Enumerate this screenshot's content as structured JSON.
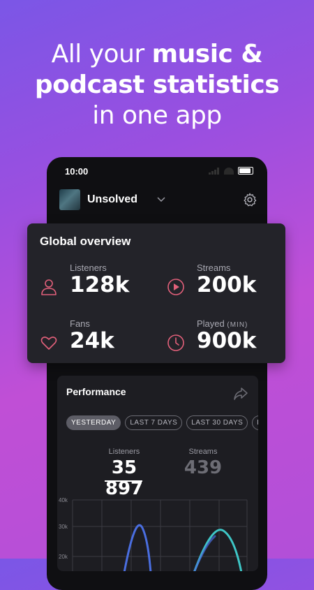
{
  "headline": {
    "part1": "All your ",
    "bold1": "music &",
    "bold2": "podcast statistics",
    "part3": "in one app"
  },
  "status_bar": {
    "time": "10:00"
  },
  "app_header": {
    "title": "Unsolved"
  },
  "global_overview": {
    "title": "Global overview",
    "stats": [
      {
        "label": "Listeners",
        "value": "128k",
        "icon": "person-icon"
      },
      {
        "label": "Streams",
        "value": "200k",
        "icon": "play-icon"
      },
      {
        "label": "Fans",
        "value": "24k",
        "icon": "heart-icon"
      },
      {
        "label": "Played",
        "unit": "(MIN)",
        "value": "900k",
        "icon": "clock-icon"
      }
    ]
  },
  "performance": {
    "title": "Performance",
    "chips": [
      "YESTERDAY",
      "LAST 7 DAYS",
      "LAST 30 DAYS",
      "LAS"
    ],
    "active_chip": "YESTERDAY",
    "metrics": [
      {
        "label": "Listeners",
        "value": "35 897"
      },
      {
        "label": "Streams",
        "value": "439"
      }
    ]
  },
  "chart_data": {
    "type": "line",
    "y_tick_labels": [
      "40k",
      "30k",
      "20k"
    ],
    "grid": true
  },
  "colors": {
    "accent": "#e2607a",
    "line_blue": "#4a6ee0",
    "line_teal": "#3ec6c6"
  }
}
